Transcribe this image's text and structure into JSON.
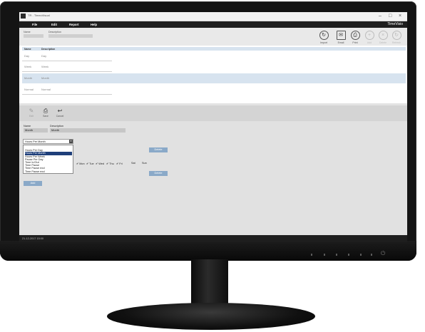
{
  "window": {
    "title": "TR - TimeoVisual",
    "brand": "TimeVisio"
  },
  "menu": [
    {
      "label": "File"
    },
    {
      "label": "Edit"
    },
    {
      "label": "Report"
    },
    {
      "label": "Help"
    }
  ],
  "filter": {
    "name_label": "Name",
    "description_label": "Description"
  },
  "toolbar": [
    {
      "label": "Import",
      "icon": "refresh-icon"
    },
    {
      "label": "Email",
      "icon": "mail-icon"
    },
    {
      "label": "Print",
      "icon": "printer-icon"
    },
    {
      "label": "Add",
      "icon": "add-icon"
    },
    {
      "label": "Delete",
      "icon": "delete-icon"
    },
    {
      "label": "Refresh",
      "icon": "reload-icon"
    }
  ],
  "grid": {
    "columns": [
      "Name",
      "Description"
    ],
    "rows": [
      {
        "name": "Day",
        "description": "Day",
        "selected": false
      },
      {
        "name": "Week",
        "description": "Week",
        "selected": false
      },
      {
        "name": "Month",
        "description": "Month",
        "selected": true
      },
      {
        "name": "Normal",
        "description": "Normal",
        "selected": false
      }
    ]
  },
  "detail_toolbar": [
    {
      "label": "Edit",
      "icon": "edit-icon",
      "enabled": false
    },
    {
      "label": "Save",
      "icon": "printer-icon",
      "enabled": true
    },
    {
      "label": "Cancel",
      "icon": "undo-icon",
      "enabled": true
    }
  ],
  "detail": {
    "name_label": "Name",
    "name_value": "Month",
    "description_label": "Description",
    "description_value": "Month",
    "rule_select": "Hours Per Month",
    "dropdown_options": [
      {
        "label": "",
        "selected": false
      },
      {
        "label": "Hours Per Day",
        "selected": false
      },
      {
        "label": "Hours Per Month",
        "selected": true
      },
      {
        "label": "Hours Per Week",
        "selected": false
      },
      {
        "label": "Pause Per Day",
        "selected": false
      },
      {
        "label": "Time In/Out",
        "selected": false
      },
      {
        "label": "Time Pause",
        "selected": false
      },
      {
        "label": "Time Pause excl",
        "selected": false
      },
      {
        "label": "Time Pause excl",
        "selected": false
      }
    ],
    "days": [
      {
        "label": "Mon",
        "checked": true
      },
      {
        "label": "Tue",
        "checked": true
      },
      {
        "label": "Wed",
        "checked": true
      },
      {
        "label": "Thu",
        "checked": true
      },
      {
        "label": "Fri",
        "checked": true
      },
      {
        "label": "Sat",
        "checked": false
      },
      {
        "label": "Sun",
        "checked": false
      }
    ],
    "delete_label": "Delete",
    "add_label": "Add"
  },
  "status": {
    "text": "21-12-2017 15:00"
  },
  "colors": {
    "menubar": "#1e1e1e",
    "selection": "#d7e3ef",
    "button": "#8aa9c8",
    "dropdown_highlight": "#1f3f7a"
  }
}
